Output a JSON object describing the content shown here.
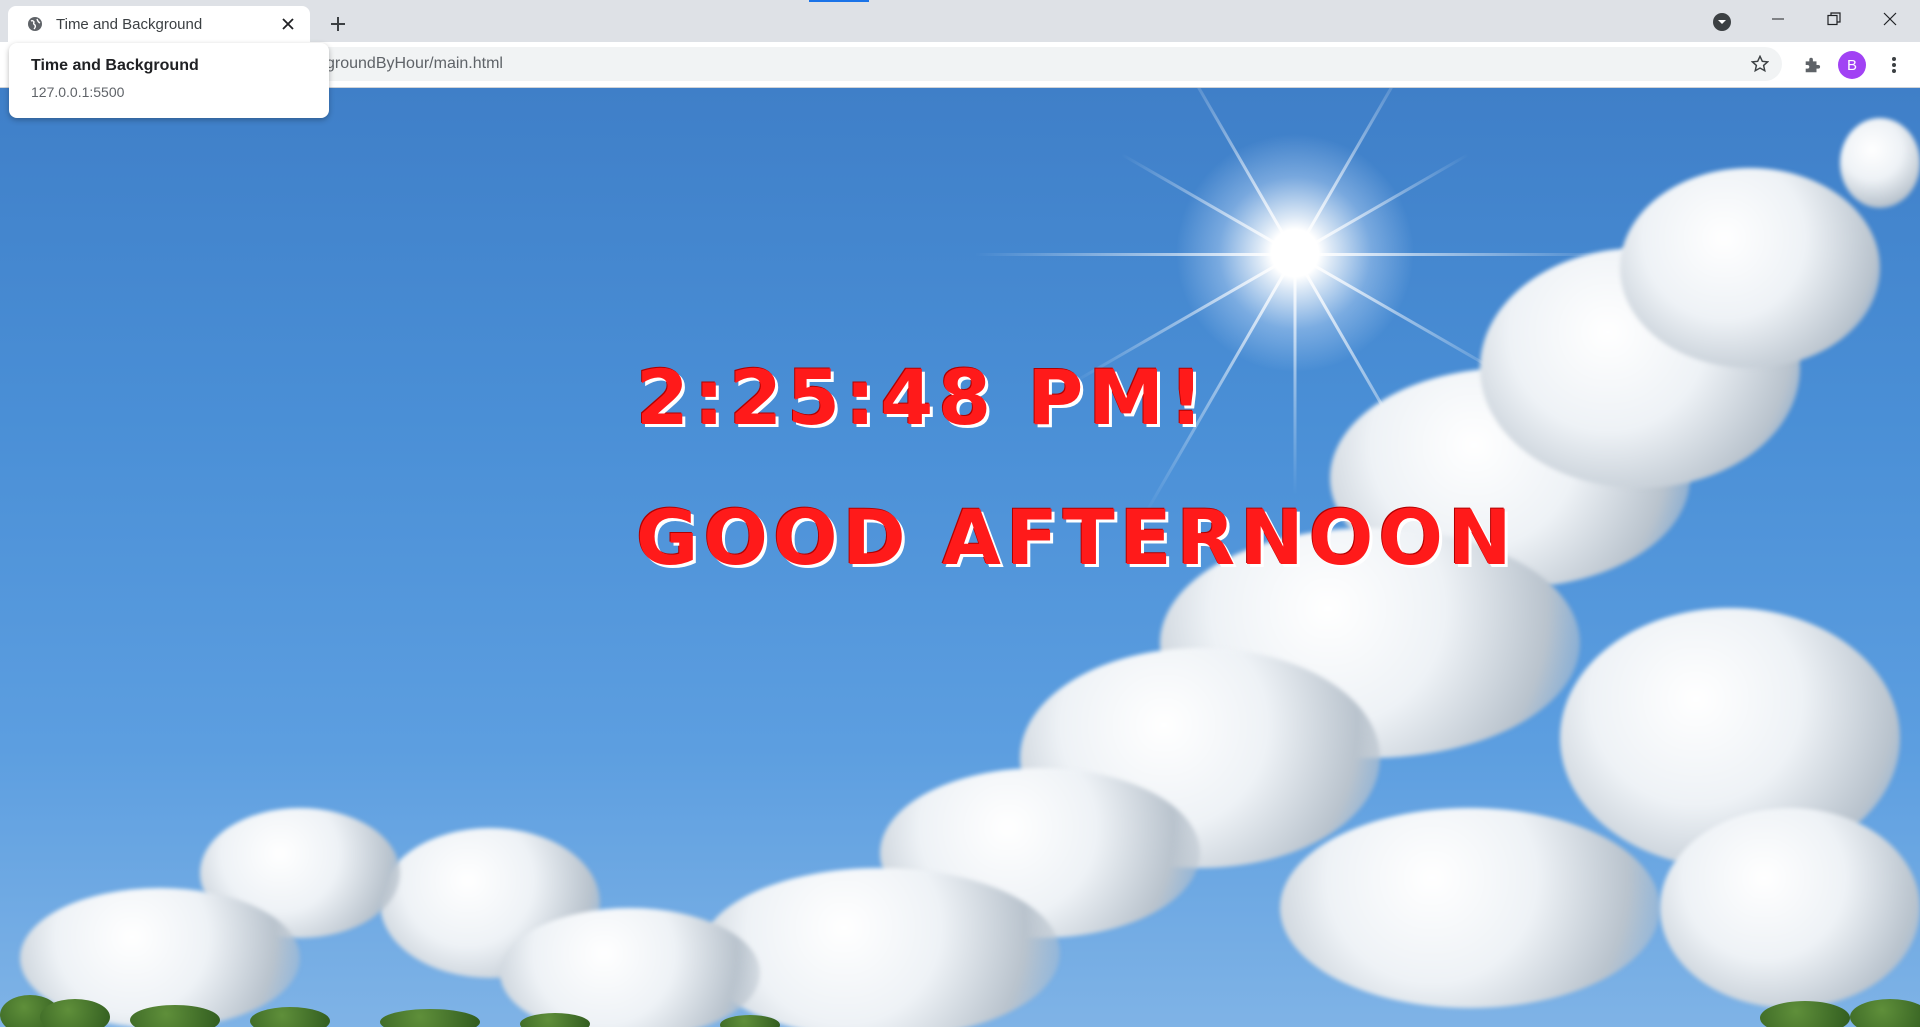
{
  "browser": {
    "tab": {
      "title": "Time and Background",
      "favicon": "globe-icon"
    },
    "hover_card": {
      "title": "Time and Background",
      "url": "127.0.0.1:5500"
    },
    "address_bar": {
      "url_visible": "kgroundByHour/main.html"
    },
    "profile": {
      "initial": "B",
      "color": "#a142f4"
    },
    "icons": [
      "globe-icon",
      "close-icon",
      "plus-icon",
      "tab-search-icon",
      "minimize-icon",
      "restore-icon",
      "close-window-icon",
      "star-icon",
      "puzzle-icon",
      "more-vert-icon"
    ]
  },
  "page": {
    "time_text": "2:25:48 PM!",
    "greeting_text": "GOOD AFTERNOON",
    "text_color": "#ff1a1a"
  }
}
